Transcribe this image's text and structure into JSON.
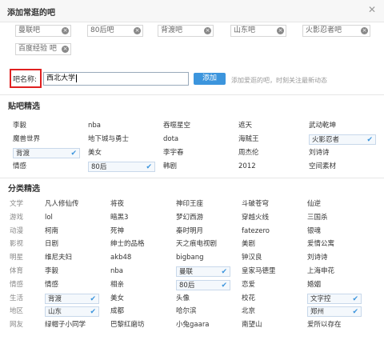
{
  "dialog": {
    "title": "添加常逛的吧"
  },
  "chips": [
    "曼联吧",
    "80后吧",
    "背渡吧",
    "山东吧",
    "火影忍者吧",
    "百度经验 吧"
  ],
  "name_field": {
    "label": "吧名称:",
    "value": "西北大学"
  },
  "add_button": "添加",
  "hint": "添加爱逛的吧，时刻关注最新动态",
  "sections": {
    "tieba": "贴吧精选",
    "category": "分类精选"
  },
  "tieba_rows": [
    [
      "李毅",
      "nba",
      "吞噬星空",
      "遮天",
      "武动乾坤"
    ],
    [
      "魔兽世界",
      "地下城与勇士",
      "dota",
      "海贼王",
      "火影忍者"
    ],
    [
      "背渡",
      "美女",
      "李宇春",
      "周杰伦",
      "刘诗诗"
    ],
    [
      "情感",
      "80后",
      "韩剧",
      "2012",
      "空间素材"
    ]
  ],
  "tieba_selected": [
    [
      1,
      4
    ],
    [
      2,
      0
    ],
    [
      3,
      1
    ]
  ],
  "category_rows": [
    {
      "label": "文学",
      "items": [
        "凡人修仙传",
        "将夜",
        "神印王座",
        "斗破苍穹",
        "仙逆"
      ]
    },
    {
      "label": "游戏",
      "items": [
        "lol",
        "暗黑3",
        "梦幻西游",
        "穿越火线",
        "三国杀"
      ]
    },
    {
      "label": "动漫",
      "items": [
        "柯南",
        "死神",
        "秦时明月",
        "fatezero",
        "银魂"
      ]
    },
    {
      "label": "影视",
      "items": [
        "日剧",
        "绅士的品格",
        "天之痕电视剧",
        "美剧",
        "爱情公寓"
      ]
    },
    {
      "label": "明星",
      "items": [
        "维尼夫妇",
        "akb48",
        "bigbang",
        "钟汉良",
        "刘诗诗"
      ]
    },
    {
      "label": "体育",
      "items": [
        "李毅",
        "nba",
        "曼联",
        "皇家马德里",
        "上海申花"
      ]
    },
    {
      "label": "情感",
      "items": [
        "情感",
        "相亲",
        "80后",
        "恋爱",
        "婚姻"
      ]
    },
    {
      "label": "生活",
      "items": [
        "背渡",
        "美女",
        "头像",
        "校花",
        "文字控"
      ]
    },
    {
      "label": "地区",
      "items": [
        "山东",
        "成都",
        "哈尔滨",
        "北京",
        "郑州"
      ]
    },
    {
      "label": "网友",
      "items": [
        "绿帽子小同学",
        "巴黎红磨坊",
        "小兔gaara",
        "南望山",
        "爱所以存在"
      ]
    }
  ],
  "category_selected": [
    [
      5,
      2
    ],
    [
      6,
      2
    ],
    [
      7,
      0
    ],
    [
      7,
      4
    ],
    [
      8,
      0
    ],
    [
      8,
      4
    ]
  ],
  "icons": {
    "close": "close-icon",
    "chip_remove": "remove-icon",
    "check": "check-icon"
  },
  "colors": {
    "accent": "#3c95dd",
    "highlight": "#e02020"
  }
}
